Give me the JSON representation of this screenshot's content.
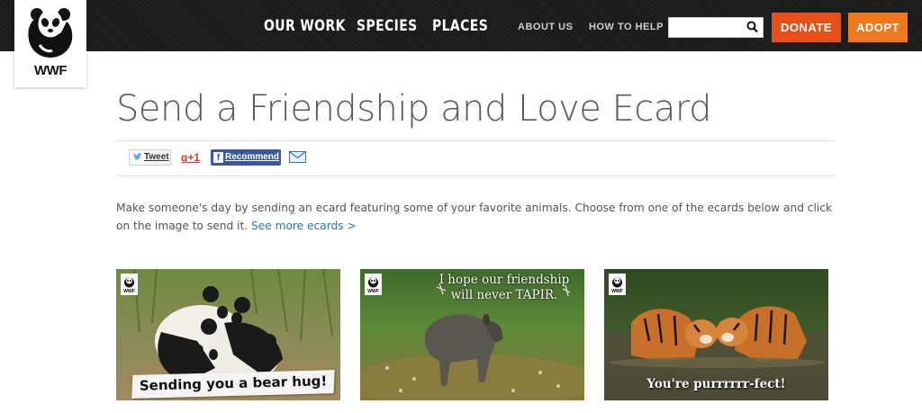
{
  "header": {
    "logo_text": "WWF",
    "nav": [
      "OUR WORK",
      "SPECIES",
      "PLACES"
    ],
    "subnav": [
      "ABOUT US",
      "HOW TO HELP"
    ],
    "search": {
      "value": "",
      "placeholder": ""
    },
    "donate_label": "DONATE",
    "adopt_label": "ADOPT",
    "colors": {
      "donate": "#e8501a",
      "adopt": "#f0791b",
      "bar": "#1b1b1b"
    }
  },
  "page": {
    "title": "Send a Friendship and Love Ecard",
    "share": {
      "tweet": "Tweet",
      "gplus": "g+1",
      "recommend": "Recommend"
    },
    "intro": "Make someone's day by sending an ecard featuring some of your favorite animals. Choose from one of the ecards below and click on the image to send it.",
    "see_more": "See more ecards >"
  },
  "cards": [
    {
      "caption": "Sending you a bear hug!",
      "badge": "WWF",
      "subject": "panda cubs hugging"
    },
    {
      "caption": "I hope our friendship will never TAPIR.",
      "badge": "WWF",
      "subject": "tapir in meadow"
    },
    {
      "caption": "You're purrrrrr-fect!",
      "badge": "WWF",
      "subject": "two tigers in water"
    }
  ]
}
